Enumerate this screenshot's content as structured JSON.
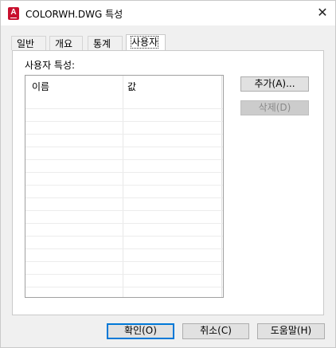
{
  "window": {
    "title": "COLORWH.DWG 특성",
    "close_glyph": "✕"
  },
  "tabs": [
    {
      "label": "일반",
      "active": false
    },
    {
      "label": "개요",
      "active": false
    },
    {
      "label": "통계",
      "active": false
    },
    {
      "label": "사용자",
      "active": true
    }
  ],
  "custom": {
    "group_label": "사용자 특성:",
    "columns": [
      "이름",
      "값"
    ],
    "rows": [],
    "add_button": "추가(A)...",
    "delete_button": "삭제(D)"
  },
  "footer": {
    "ok_button": "확인(O)",
    "cancel_button": "취소(C)",
    "help_button": "도움말(H)"
  },
  "colors": {
    "accent": "#0078d7",
    "app_icon": "#c8102e"
  }
}
